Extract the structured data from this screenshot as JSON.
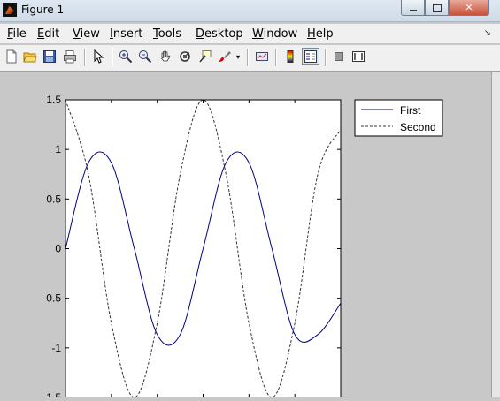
{
  "window": {
    "title": "Figure 1",
    "close_label": "✕"
  },
  "menu": [
    {
      "mnemonic": "F",
      "rest": "ile"
    },
    {
      "mnemonic": "E",
      "rest": "dit"
    },
    {
      "mnemonic": "V",
      "rest": "iew"
    },
    {
      "mnemonic": "I",
      "rest": "nsert"
    },
    {
      "mnemonic": "T",
      "rest": "ools"
    },
    {
      "mnemonic": "D",
      "rest": "esktop"
    },
    {
      "mnemonic": "W",
      "rest": "indow"
    },
    {
      "mnemonic": "H",
      "rest": "elp"
    }
  ],
  "toolbar": {
    "icons": [
      "new-figure-icon",
      "open-file-icon",
      "save-icon",
      "print-icon",
      "edit-plot-arrow-icon",
      "zoom-in-icon",
      "zoom-out-icon",
      "pan-hand-icon",
      "rotate-3d-icon",
      "data-cursor-icon",
      "brush-icon",
      "link-plot-icon",
      "colorbar-icon",
      "legend-icon",
      "hide-plot-tools-icon",
      "show-plot-tools-icon"
    ]
  },
  "chart_data": {
    "type": "line",
    "title": "",
    "xlabel": "",
    "ylabel": "",
    "ylim": [
      -1.5,
      1.5
    ],
    "xlim": [
      0,
      3.14159
    ],
    "yticks": [
      "1.5",
      "1",
      "0.5",
      "0",
      "-0.5",
      "-1",
      "-1.5"
    ],
    "ytick_values": [
      1.5,
      1,
      0.5,
      0,
      -0.5,
      -1,
      -1.5
    ],
    "xtick_values": [
      0.5236,
      1.0472,
      1.5708,
      2.0944,
      2.618,
      3.1416
    ],
    "grid": false,
    "legend_position": "top-right outside",
    "series": [
      {
        "name": "First",
        "style": "solid",
        "color": "#000080",
        "x": [
          0,
          0.2618,
          0.5236,
          0.7854,
          1.0472,
          1.309,
          1.5708,
          1.8326,
          2.0944,
          2.3562,
          2.618,
          2.8798,
          3.1416
        ],
        "y": [
          0,
          0.866,
          0.866,
          0,
          -0.866,
          -0.866,
          0,
          0.866,
          0.866,
          0,
          -0.866,
          -0.866,
          -0.55
        ]
      },
      {
        "name": "Second",
        "style": "dashed",
        "color": "#333333",
        "x": [
          0,
          0.2618,
          0.5236,
          0.7854,
          1.0472,
          1.309,
          1.5708,
          1.8326,
          2.0944,
          2.3562,
          2.618,
          2.8798,
          3.1416
        ],
        "y": [
          1.5,
          0.75,
          -0.75,
          -1.5,
          -0.75,
          0.75,
          1.5,
          0.75,
          -0.75,
          -1.5,
          -0.75,
          0.75,
          1.2
        ]
      }
    ]
  }
}
